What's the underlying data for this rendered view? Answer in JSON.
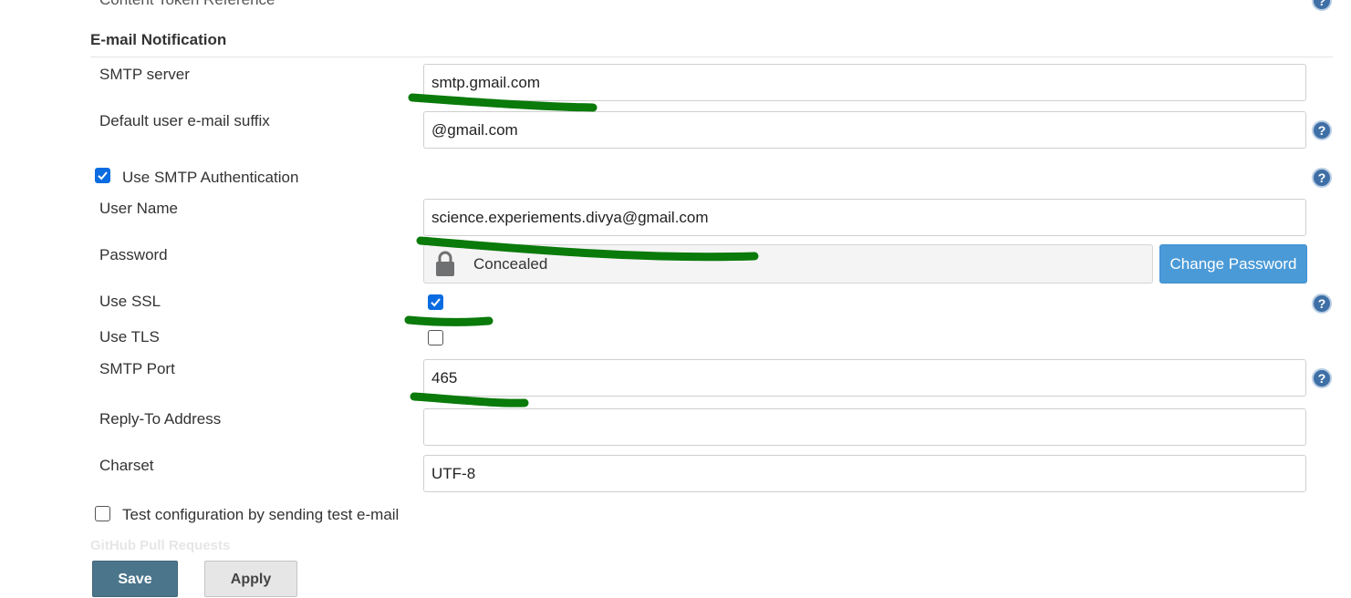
{
  "top_cut_label": "Content Token Reference",
  "section": {
    "title": "E-mail Notification"
  },
  "fields": {
    "smtp_server": {
      "label": "SMTP server",
      "value": "smtp.gmail.com"
    },
    "email_suffix": {
      "label": "Default user e-mail suffix",
      "value": "@gmail.com"
    },
    "use_smtp_auth": {
      "label": "Use SMTP Authentication",
      "checked": true
    },
    "user_name": {
      "label": "User Name",
      "value": "science.experiements.divya@gmail.com"
    },
    "password": {
      "label": "Password",
      "concealed_text": "Concealed",
      "change_label": "Change Password"
    },
    "use_ssl": {
      "label": "Use SSL",
      "checked": true
    },
    "use_tls": {
      "label": "Use TLS",
      "checked": false
    },
    "smtp_port": {
      "label": "SMTP Port",
      "value": "465"
    },
    "reply_to": {
      "label": "Reply-To Address",
      "value": ""
    },
    "charset": {
      "label": "Charset",
      "value": "UTF-8"
    },
    "test_config": {
      "label": "Test configuration by sending test e-mail",
      "checked": false
    }
  },
  "next_section_faded": "GitHub Pull Requests",
  "buttons": {
    "save": "Save",
    "apply": "Apply"
  },
  "colors": {
    "checkbox_accent": "#0a6ce0",
    "change_password_button": "#4a9ad7",
    "save_button": "#4b758b",
    "help_icon": "#3e6fa6",
    "annotation_marker": "#0a7a0a"
  }
}
